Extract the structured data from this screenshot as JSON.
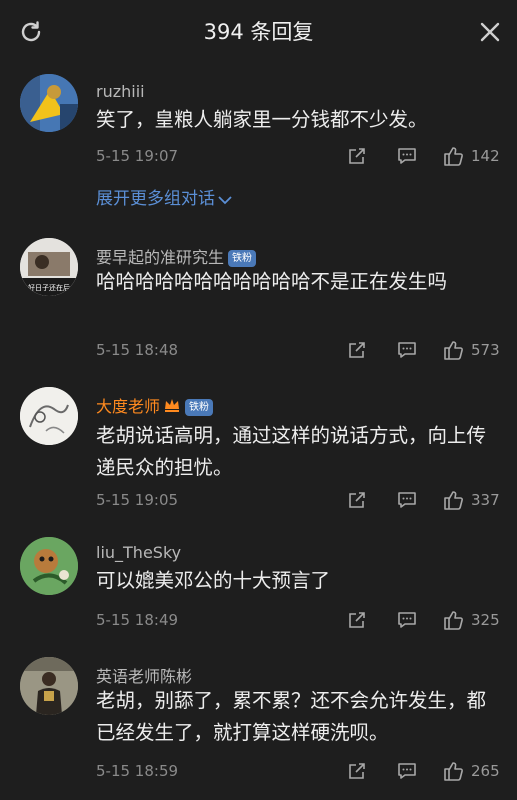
{
  "header": {
    "title": "394 条回复"
  },
  "comments": [
    {
      "name": "ruzhiii",
      "badge": "",
      "text": "笑了，皇粮人躺家里一分钱都不少发。",
      "time": "5-15 19:07",
      "likes": "142",
      "expand": "展开更多组对话"
    },
    {
      "name": "要早起的准研究生",
      "badge": "铁粉",
      "text": "哈哈哈哈哈哈哈哈哈哈哈不是正在发生吗",
      "time": "5-15 18:48",
      "likes": "573",
      "avatar_text": "好日子还在后"
    },
    {
      "name": "大度老师",
      "badge": "铁粉",
      "text": "老胡说话高明，通过这样的说话方式，向上传递民众的担忧。",
      "time": "5-15 19:05",
      "likes": "337"
    },
    {
      "name": "liu_TheSky",
      "badge": "",
      "text": "可以媲美邓公的十大预言了",
      "time": "5-15 18:49",
      "likes": "325"
    },
    {
      "name": "英语老师陈彬",
      "badge": "",
      "text": "老胡，别舔了，累不累？还不会允许发生，都已经发生了，就打算这样硬洗呗。",
      "time": "5-15 18:59",
      "likes": "265"
    }
  ],
  "colors": {
    "background": "#1e1e1e",
    "vip_name": "#ff8a1f",
    "link": "#5b8fd6",
    "badge": "#4a79b8"
  },
  "icons": [
    "refresh-icon",
    "close-icon",
    "share-icon",
    "reply-icon",
    "like-icon",
    "chevron-down-icon",
    "crown-icon"
  ]
}
